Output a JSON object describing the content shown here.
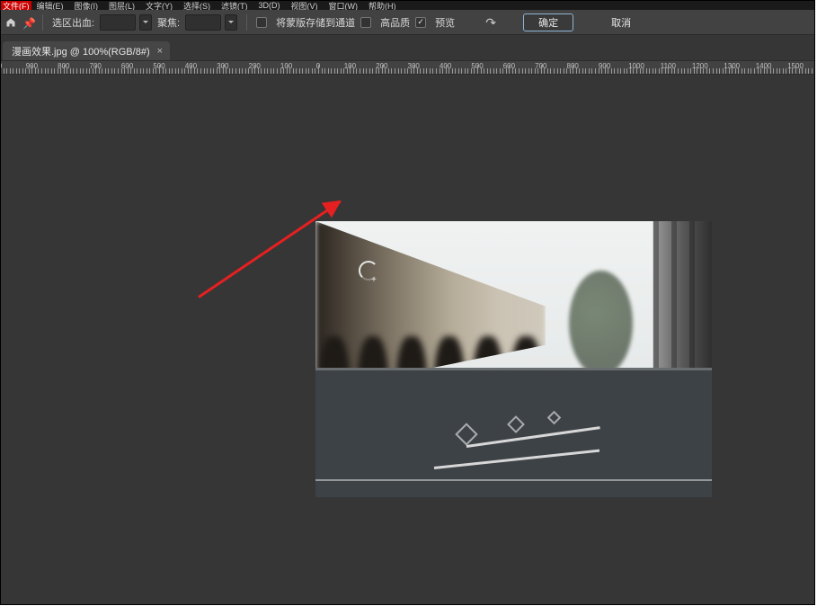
{
  "menus": {
    "file": "文件(F)",
    "items": [
      "编辑(E)",
      "图像(I)",
      "图层(L)",
      "文字(Y)",
      "选择(S)",
      "滤镜(T)",
      "3D(D)",
      "视图(V)",
      "窗口(W)",
      "帮助(H)"
    ]
  },
  "options": {
    "bleed_label": "选区出血:",
    "bleed_value": "",
    "focus_label": "聚焦:",
    "focus_value": "",
    "save_alpha": "将蒙版存储到通道",
    "high_quality": "高品质",
    "preview": "预览",
    "ok": "确定",
    "cancel": "取消"
  },
  "tab": {
    "title": "漫画效果.jpg @ 100%(RGB/8#)",
    "close": "×"
  },
  "ruler": {
    "values": [
      "0",
      "900",
      "800",
      "700",
      "600",
      "500",
      "400",
      "300",
      "200",
      "100",
      "0",
      "100",
      "200",
      "300",
      "400",
      "500",
      "600",
      "700",
      "800",
      "900",
      "1000",
      "1100",
      "1200",
      "1300",
      "1400",
      "1500"
    ]
  }
}
